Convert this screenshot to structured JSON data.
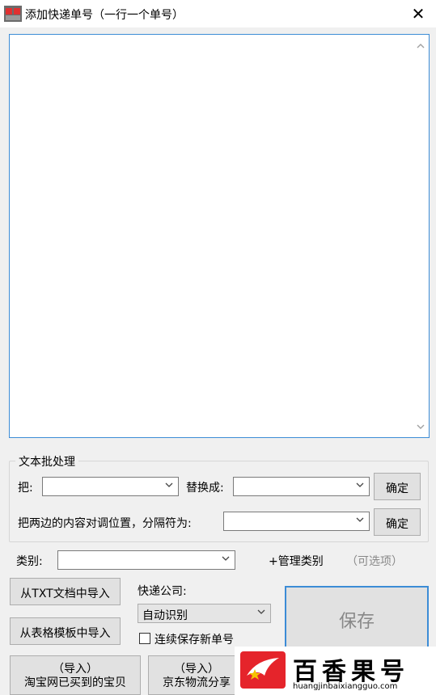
{
  "window": {
    "title": "添加快递单号（一行一个单号）",
    "close_glyph": "✕"
  },
  "editor": {
    "value": ""
  },
  "batch": {
    "group_title": "文本批处理",
    "replace_from_label": "把:",
    "replace_from_value": "",
    "replace_to_label": "替换成:",
    "replace_to_value": "",
    "confirm1": "确定",
    "swap_label": "把两边的内容对调位置，分隔符为:",
    "swap_value": "",
    "confirm2": "确定"
  },
  "category": {
    "label": "类别:",
    "value": "",
    "manage": "+管理类别",
    "optional": "（可选项）"
  },
  "import": {
    "txt": "从TXT文档中导入",
    "sheet": "从表格模板中导入",
    "taobao_line1": "（导入）",
    "taobao_line2": "淘宝网已买到的宝贝",
    "jd_line1": "（导入）",
    "jd_line2": "京东物流分享"
  },
  "courier": {
    "label": "快递公司:",
    "value": "自动识别",
    "continuous": "连续保存新单号",
    "continuous_checked": false
  },
  "save": {
    "label": "保存"
  },
  "watermark": {
    "text": "百香果号",
    "url": "huangjinbaixiangguo.com"
  },
  "colors": {
    "accent": "#3c8cd6",
    "watermark_red": "#e5242b"
  }
}
